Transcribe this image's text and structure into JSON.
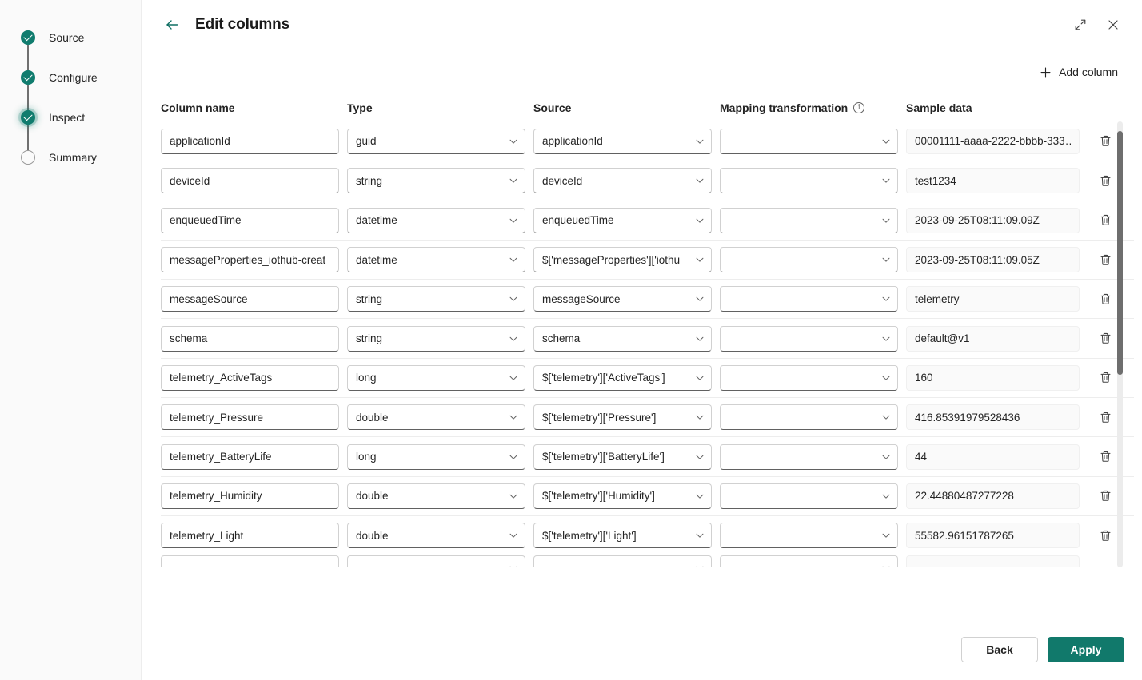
{
  "wizard": {
    "steps": [
      {
        "label": "Source",
        "state": "done"
      },
      {
        "label": "Configure",
        "state": "done"
      },
      {
        "label": "Inspect",
        "state": "done-focused"
      },
      {
        "label": "Summary",
        "state": "pending"
      }
    ]
  },
  "header": {
    "title": "Edit columns",
    "back_icon": "arrow-left-icon",
    "expand_icon": "expand-diagonal-icon",
    "close_icon": "close-icon"
  },
  "toolbar": {
    "add_column_label": "Add column",
    "add_icon": "plus-icon"
  },
  "grid": {
    "columns": [
      {
        "key": "name",
        "label": "Column name"
      },
      {
        "key": "type",
        "label": "Type"
      },
      {
        "key": "source",
        "label": "Source"
      },
      {
        "key": "mapping",
        "label": "Mapping transformation",
        "info": true
      },
      {
        "key": "sample",
        "label": "Sample data"
      }
    ],
    "info_glyph": "i",
    "delete_icon": "trash-icon",
    "chevron_icon": "chevron-down-icon",
    "rows": [
      {
        "name": "applicationId",
        "type": "guid",
        "source": "applicationId",
        "mapping": "",
        "sample": "00001111-aaaa-2222-bbbb-333…"
      },
      {
        "name": "deviceId",
        "type": "string",
        "source": "deviceId",
        "mapping": "",
        "sample": "test1234"
      },
      {
        "name": "enqueuedTime",
        "type": "datetime",
        "source": "enqueuedTime",
        "mapping": "",
        "sample": "2023-09-25T08:11:09.09Z"
      },
      {
        "name": "messageProperties_iothub-creat",
        "type": "datetime",
        "source": "$['messageProperties']['iothu",
        "mapping": "",
        "sample": "2023-09-25T08:11:09.05Z"
      },
      {
        "name": "messageSource",
        "type": "string",
        "source": "messageSource",
        "mapping": "",
        "sample": "telemetry"
      },
      {
        "name": "schema",
        "type": "string",
        "source": "schema",
        "mapping": "",
        "sample": "default@v1"
      },
      {
        "name": "telemetry_ActiveTags",
        "type": "long",
        "source": "$['telemetry']['ActiveTags']",
        "mapping": "",
        "sample": "160"
      },
      {
        "name": "telemetry_Pressure",
        "type": "double",
        "source": "$['telemetry']['Pressure']",
        "mapping": "",
        "sample": "416.85391979528436"
      },
      {
        "name": "telemetry_BatteryLife",
        "type": "long",
        "source": "$['telemetry']['BatteryLife']",
        "mapping": "",
        "sample": "44"
      },
      {
        "name": "telemetry_Humidity",
        "type": "double",
        "source": "$['telemetry']['Humidity']",
        "mapping": "",
        "sample": "22.44880487277228"
      },
      {
        "name": "telemetry_Light",
        "type": "double",
        "source": "$['telemetry']['Light']",
        "mapping": "",
        "sample": "55582.96151787265"
      },
      {
        "name": "",
        "type": "",
        "source": "",
        "mapping": "",
        "sample": "",
        "clipped": true
      }
    ]
  },
  "footer": {
    "back_label": "Back",
    "apply_label": "Apply"
  },
  "colors": {
    "accent": "#11796b",
    "step_done": "#107c6e",
    "back_arrow": "#0f6f63",
    "field_border": "#d1d1d1",
    "field_underline": "#616161",
    "sample_bg": "#fafafa",
    "scrollbar_thumb": "#6e6e6e"
  }
}
